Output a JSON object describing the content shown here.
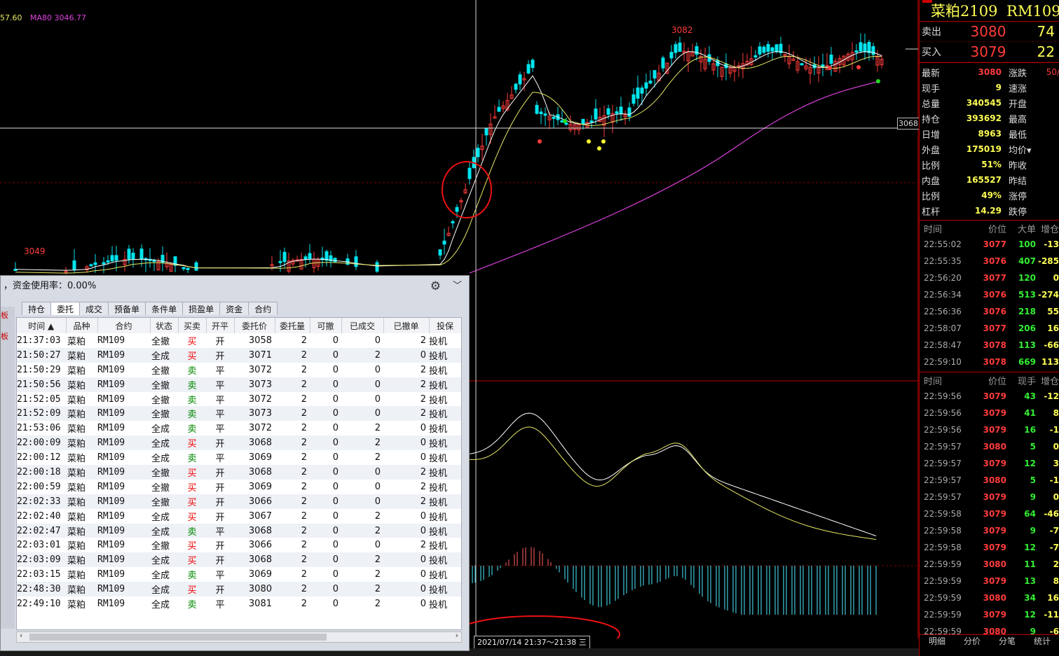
{
  "ma_legend": {
    "ma_a_label": "57.60",
    "ma80_label": "MA80 3046.77"
  },
  "colors": {
    "up": "#ff3b3b",
    "down": "#00e5ee",
    "ma80": "#e040e0",
    "ma_yellow": "#e8e864",
    "buy": "#e00000",
    "sell": "#008000"
  },
  "chart": {
    "high_label": "3082",
    "low_label": "3049",
    "cross_price": "3068",
    "time_tip": "2021/07/14 21:37〜21:38 三"
  },
  "title": {
    "marker": "M",
    "name": "菜粕2109",
    "code": "RM109"
  },
  "quote": {
    "ask_label": "卖出",
    "ask_price": "3080",
    "ask_vol": "74",
    "bid_label": "买入",
    "bid_price": "3079",
    "bid_vol": "22"
  },
  "stats": [
    {
      "k1": "最新",
      "v1": "3080",
      "c1": "#ff3b3b",
      "k2": "涨跌",
      "v2": "50/"
    },
    {
      "k1": "现手",
      "v1": "9",
      "c1": "#ffff55",
      "k2": "速涨",
      "v2": ""
    },
    {
      "k1": "总量",
      "v1": "340545",
      "c1": "#ffff55",
      "k2": "开盘",
      "v2": ""
    },
    {
      "k1": "持仓",
      "v1": "393692",
      "c1": "#ffff55",
      "k2": "最高",
      "v2": ""
    },
    {
      "k1": "日增",
      "v1": "8963",
      "c1": "#ffff55",
      "k2": "最低",
      "v2": ""
    },
    {
      "k1": "外盘",
      "v1": "175019",
      "c1": "#ffff55",
      "k2": "均价▾",
      "v2": ""
    },
    {
      "k1": "比例",
      "v1": "51%",
      "c1": "#ffff55",
      "k2": "昨收",
      "v2": ""
    },
    {
      "k1": "内盘",
      "v1": "165527",
      "c1": "#ffff55",
      "k2": "昨结",
      "v2": ""
    },
    {
      "k1": "比例",
      "v1": "49%",
      "c1": "#ffff55",
      "k2": "涨停",
      "v2": ""
    },
    {
      "k1": "杠杆",
      "v1": "14.29",
      "c1": "#ffff55",
      "k2": "跌停",
      "v2": ""
    }
  ],
  "big_orders": {
    "headers": [
      "时间",
      "价位",
      "大单",
      "增仓"
    ],
    "rows": [
      {
        "time": "22:55:02",
        "price": "3077",
        "vol": "100",
        "oi": "-13"
      },
      {
        "time": "22:55:35",
        "price": "3076",
        "vol": "407",
        "oi": "-285"
      },
      {
        "time": "22:56:20",
        "price": "3077",
        "vol": "120",
        "oi": "0"
      },
      {
        "time": "22:56:34",
        "price": "3076",
        "vol": "513",
        "oi": "-274"
      },
      {
        "time": "22:56:36",
        "price": "3076",
        "vol": "218",
        "oi": "55"
      },
      {
        "time": "22:58:07",
        "price": "3077",
        "vol": "206",
        "oi": "16"
      },
      {
        "time": "22:58:47",
        "price": "3078",
        "vol": "113",
        "oi": "-66"
      },
      {
        "time": "22:59:10",
        "price": "3078",
        "vol": "669",
        "oi": "113"
      }
    ]
  },
  "ticks": {
    "headers": [
      "时间",
      "价位",
      "现手",
      "增仓"
    ],
    "rows": [
      {
        "time": "22:59:56",
        "price": "3079",
        "vol": "43",
        "oi": "-12"
      },
      {
        "time": "22:59:56",
        "price": "3079",
        "vol": "41",
        "oi": "8"
      },
      {
        "time": "22:59:56",
        "price": "3079",
        "vol": "16",
        "oi": "-1"
      },
      {
        "time": "22:59:57",
        "price": "3080",
        "vol": "5",
        "oi": "0"
      },
      {
        "time": "22:59:57",
        "price": "3079",
        "vol": "12",
        "oi": "3"
      },
      {
        "time": "22:59:57",
        "price": "3080",
        "vol": "5",
        "oi": "-1"
      },
      {
        "time": "22:59:57",
        "price": "3079",
        "vol": "9",
        "oi": "0"
      },
      {
        "time": "22:59:58",
        "price": "3079",
        "vol": "64",
        "oi": "-46"
      },
      {
        "time": "22:59:58",
        "price": "3079",
        "vol": "9",
        "oi": "-7"
      },
      {
        "time": "22:59:58",
        "price": "3079",
        "vol": "12",
        "oi": "-7"
      },
      {
        "time": "22:59:59",
        "price": "3080",
        "vol": "11",
        "oi": "2"
      },
      {
        "time": "22:59:59",
        "price": "3079",
        "vol": "13",
        "oi": "8"
      },
      {
        "time": "22:59:59",
        "price": "3080",
        "vol": "34",
        "oi": "16"
      },
      {
        "time": "22:59:59",
        "price": "3079",
        "vol": "12",
        "oi": "-11"
      },
      {
        "time": "22:59:59",
        "price": "3080",
        "vol": "9",
        "oi": "-6"
      }
    ]
  },
  "bottom_tabs": [
    "明细",
    "分价",
    "分笔",
    "统计"
  ],
  "order_window": {
    "header_text": "，资金使用率：0.00%",
    "left_labels": [
      "板",
      "板"
    ],
    "tabs": [
      "持仓",
      "委托",
      "成交",
      "预备单",
      "条件单",
      "损盈单",
      "资金",
      "合约"
    ],
    "active_tab": 1,
    "columns": [
      "时间 ▲",
      "品种",
      "合约",
      "状态",
      "买卖",
      "开平",
      "委托价",
      "委托量",
      "可撤",
      "已成交",
      "已撤单",
      "投保"
    ],
    "rows": [
      [
        "21:37:03",
        "菜粕",
        "RM109",
        "全撤",
        "买",
        "开",
        "3058",
        "2",
        "0",
        "0",
        "2",
        "投机"
      ],
      [
        "21:50:27",
        "菜粕",
        "RM109",
        "全成",
        "买",
        "开",
        "3071",
        "2",
        "0",
        "2",
        "0",
        "投机"
      ],
      [
        "21:50:29",
        "菜粕",
        "RM109",
        "全撤",
        "卖",
        "平",
        "3072",
        "2",
        "0",
        "0",
        "2",
        "投机"
      ],
      [
        "21:50:56",
        "菜粕",
        "RM109",
        "全撤",
        "卖",
        "平",
        "3073",
        "2",
        "0",
        "0",
        "2",
        "投机"
      ],
      [
        "21:52:05",
        "菜粕",
        "RM109",
        "全撤",
        "卖",
        "平",
        "3072",
        "2",
        "0",
        "0",
        "2",
        "投机"
      ],
      [
        "21:52:09",
        "菜粕",
        "RM109",
        "全撤",
        "卖",
        "平",
        "3073",
        "2",
        "0",
        "0",
        "2",
        "投机"
      ],
      [
        "21:53:06",
        "菜粕",
        "RM109",
        "全成",
        "卖",
        "平",
        "3072",
        "2",
        "0",
        "2",
        "0",
        "投机"
      ],
      [
        "22:00:09",
        "菜粕",
        "RM109",
        "全成",
        "买",
        "开",
        "3068",
        "2",
        "0",
        "2",
        "0",
        "投机"
      ],
      [
        "22:00:12",
        "菜粕",
        "RM109",
        "全成",
        "卖",
        "平",
        "3069",
        "2",
        "0",
        "2",
        "0",
        "投机"
      ],
      [
        "22:00:18",
        "菜粕",
        "RM109",
        "全撤",
        "买",
        "开",
        "3068",
        "2",
        "0",
        "0",
        "2",
        "投机"
      ],
      [
        "22:00:59",
        "菜粕",
        "RM109",
        "全撤",
        "买",
        "开",
        "3069",
        "2",
        "0",
        "0",
        "2",
        "投机"
      ],
      [
        "22:02:33",
        "菜粕",
        "RM109",
        "全撤",
        "买",
        "开",
        "3066",
        "2",
        "0",
        "0",
        "2",
        "投机"
      ],
      [
        "22:02:40",
        "菜粕",
        "RM109",
        "全成",
        "买",
        "开",
        "3067",
        "2",
        "0",
        "2",
        "0",
        "投机"
      ],
      [
        "22:02:47",
        "菜粕",
        "RM109",
        "全成",
        "卖",
        "平",
        "3068",
        "2",
        "0",
        "2",
        "0",
        "投机"
      ],
      [
        "22:03:01",
        "菜粕",
        "RM109",
        "全撤",
        "买",
        "开",
        "3066",
        "2",
        "0",
        "0",
        "2",
        "投机"
      ],
      [
        "22:03:09",
        "菜粕",
        "RM109",
        "全成",
        "买",
        "开",
        "3068",
        "2",
        "0",
        "2",
        "0",
        "投机"
      ],
      [
        "22:03:15",
        "菜粕",
        "RM109",
        "全成",
        "卖",
        "平",
        "3069",
        "2",
        "0",
        "2",
        "0",
        "投机"
      ],
      [
        "22:48:30",
        "菜粕",
        "RM109",
        "全成",
        "买",
        "开",
        "3080",
        "2",
        "0",
        "2",
        "0",
        "投机"
      ],
      [
        "22:49:10",
        "菜粕",
        "RM109",
        "全成",
        "卖",
        "平",
        "3081",
        "2",
        "0",
        "2",
        "0",
        "投机"
      ]
    ]
  }
}
